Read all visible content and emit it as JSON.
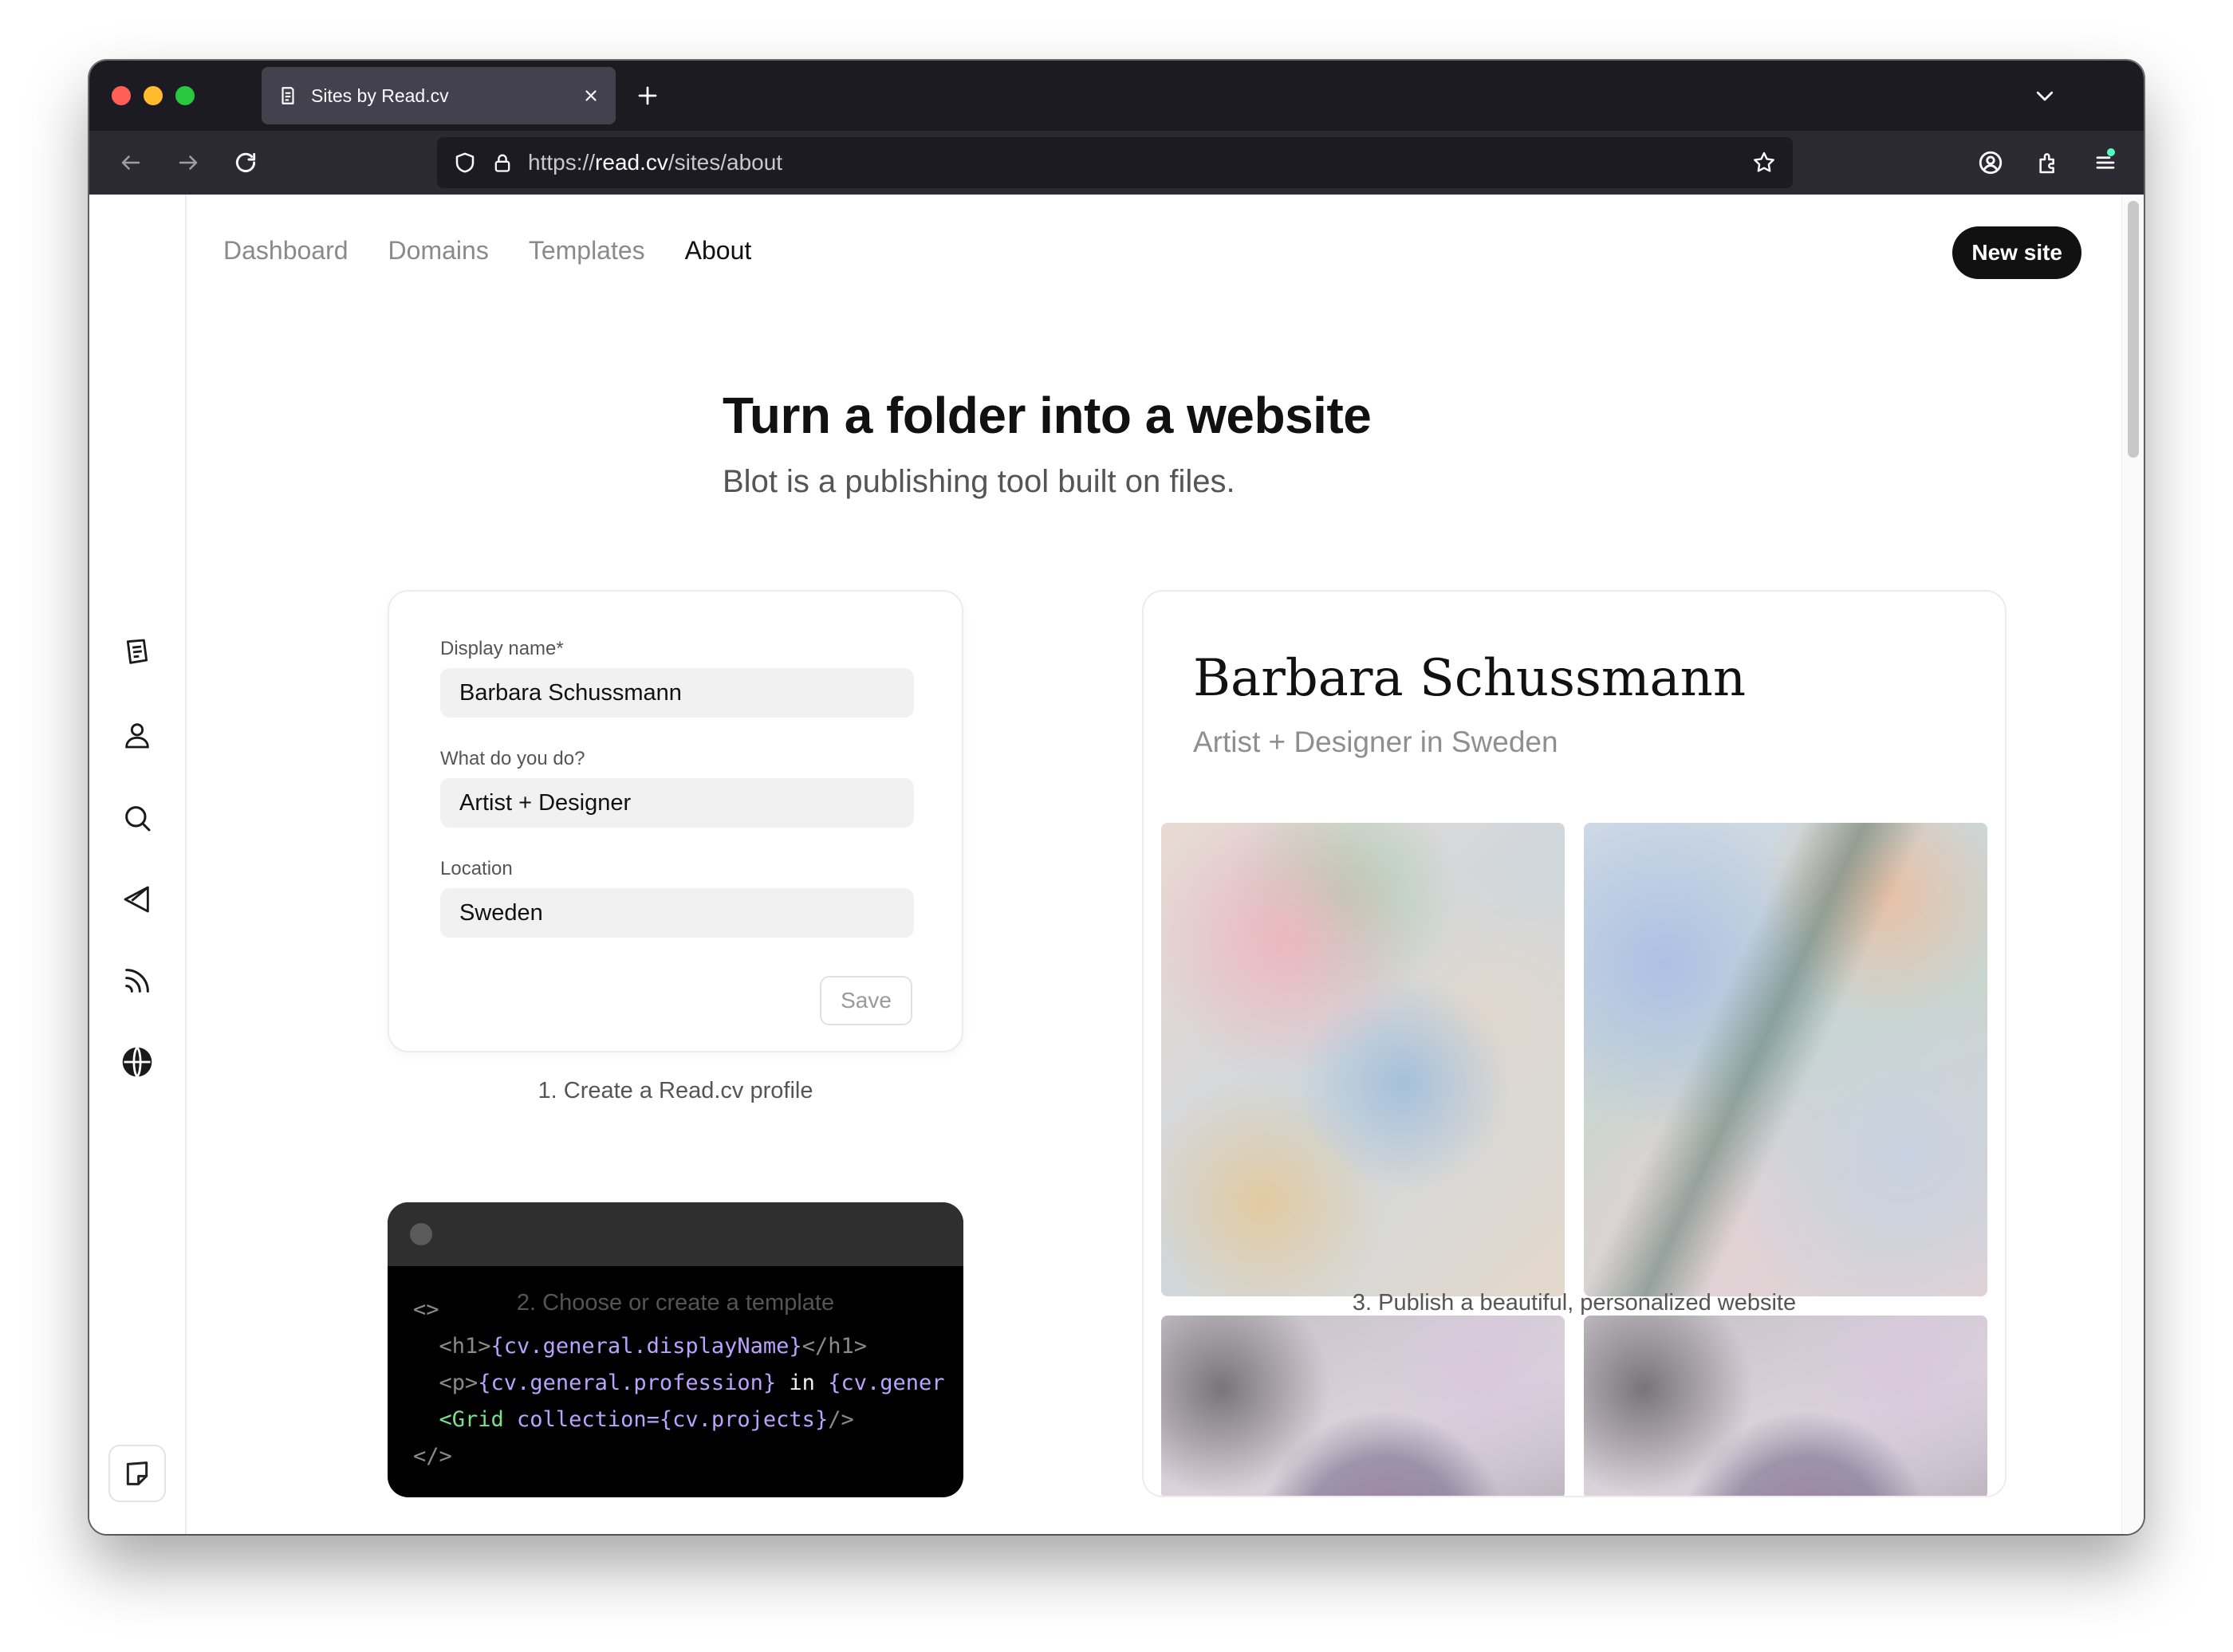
{
  "browser": {
    "tab_title": "Sites by Read.cv",
    "url_prefix": "https://",
    "url_host": "read.cv",
    "url_path": "/sites/about"
  },
  "topnav": {
    "items": [
      "Dashboard",
      "Domains",
      "Templates",
      "About"
    ],
    "active": "About",
    "new_site_label": "New site"
  },
  "hero": {
    "title": "Turn a folder into a website",
    "subtitle": "Blot is a publishing tool built on files."
  },
  "profile_form": {
    "display_name_label": "Display name*",
    "display_name_value": "Barbara Schussmann",
    "profession_label": "What do you do?",
    "profession_value": "Artist + Designer",
    "location_label": "Location",
    "location_value": "Sweden",
    "save_label": "Save",
    "caption": "1. Create a Read.cv profile"
  },
  "code_example": {
    "line1": "<>",
    "line2_open": "<h1>",
    "line2_expr": "{cv.general.displayName}",
    "line2_close": "</h1>",
    "line3_open": "<p>",
    "line3_expr": "{cv.general.profession}",
    "line3_mid": " in ",
    "line3_tail": "{cv.gener",
    "line4_tag": "<Grid",
    "line4_attr": " collection=",
    "line4_expr": "{cv.projects}",
    "line4_close": "/>",
    "line5": "</>",
    "caption": "2. Choose or create a template"
  },
  "preview": {
    "name": "Barbara Schussmann",
    "subtitle": "Artist + Designer in Sweden",
    "caption": "3. Publish a beautiful, personalized website"
  },
  "icons": {
    "rail": [
      "document-icon",
      "person-icon",
      "search-icon",
      "send-icon",
      "rss-icon",
      "globe-icon"
    ],
    "rail_bottom": "note-icon"
  }
}
